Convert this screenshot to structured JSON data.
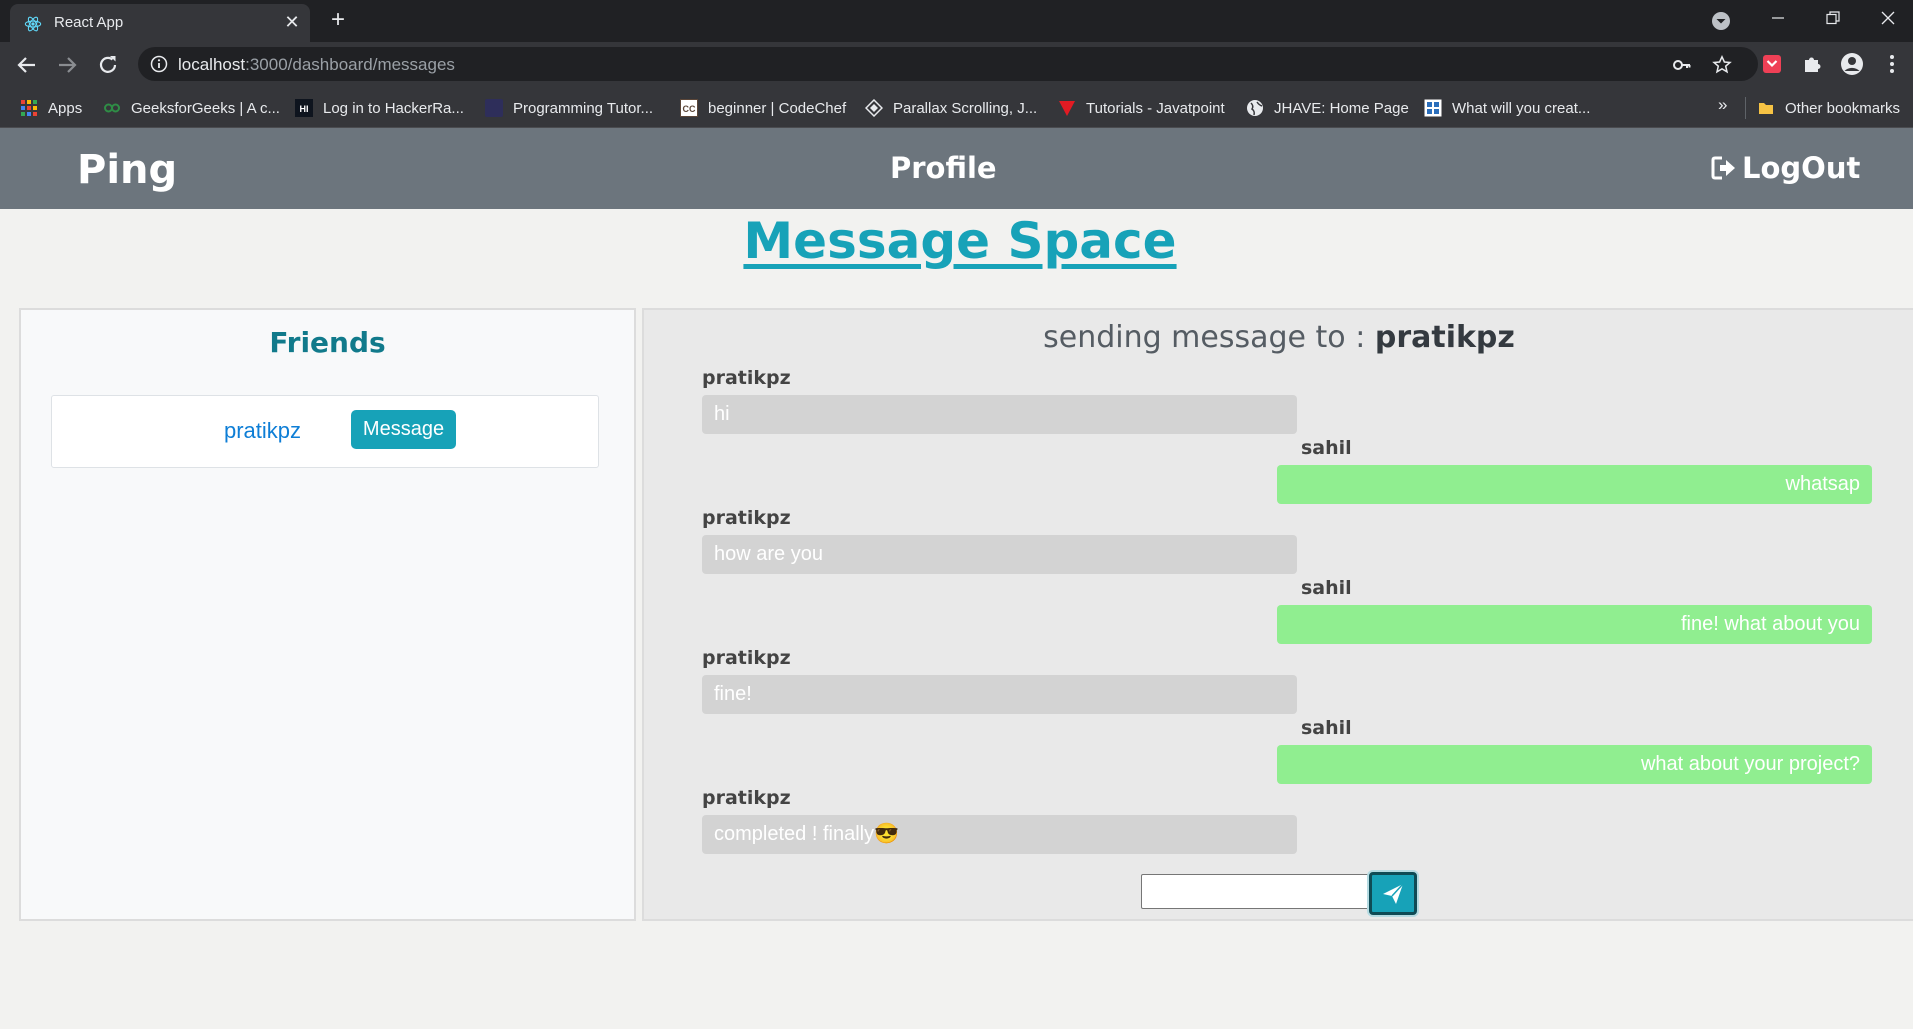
{
  "browser": {
    "tab_title": "React App",
    "tab_close": "✕",
    "new_tab": "+",
    "url_host": "localhost",
    "url_path": ":3000/dashboard/messages",
    "bookmarks": [
      {
        "label": "Apps",
        "icon": "apps-grid-icon"
      },
      {
        "label": "GeeksforGeeks | A c...",
        "icon": "geeksforgeeks-icon"
      },
      {
        "label": "Log in to HackerRa...",
        "icon": "hackerrank-icon"
      },
      {
        "label": "Programming Tutor...",
        "icon": "programiz-icon"
      },
      {
        "label": "beginner | CodeChef",
        "icon": "codechef-icon"
      },
      {
        "label": "Parallax Scrolling, J...",
        "icon": "parallax-icon"
      },
      {
        "label": "Tutorials - Javatpoint",
        "icon": "javatpoint-icon"
      },
      {
        "label": "JHAVE: Home Page",
        "icon": "globe-icon"
      },
      {
        "label": "What will you creat...",
        "icon": "creat-icon"
      }
    ],
    "bookmarks_more": "»",
    "other_bookmarks": "Other bookmarks"
  },
  "app": {
    "brand": "Ping",
    "nav_profile": "Profile",
    "nav_logout": "LogOut",
    "page_title": "Message Space"
  },
  "friends": {
    "title": "Friends",
    "items": [
      {
        "name": "pratikpz",
        "button": "Message"
      }
    ]
  },
  "chat": {
    "header_prefix": "sending message to : ",
    "recipient": "pratikpz",
    "messages": [
      {
        "sender": "pratikpz",
        "text": "hi",
        "direction": "in"
      },
      {
        "sender": "sahil",
        "text": "whatsap",
        "direction": "out"
      },
      {
        "sender": "pratikpz",
        "text": "how are you",
        "direction": "in"
      },
      {
        "sender": "sahil",
        "text": "fine! what about you",
        "direction": "out"
      },
      {
        "sender": "pratikpz",
        "text": "fine!",
        "direction": "in"
      },
      {
        "sender": "sahil",
        "text": "what about your project?",
        "direction": "out"
      },
      {
        "sender": "pratikpz",
        "text": "completed ! finally😎",
        "direction": "in"
      }
    ],
    "input_value": ""
  },
  "colors": {
    "accent": "#17a2b8",
    "navbar": "#6c757d",
    "incoming_bubble": "#d3d3d3",
    "outgoing_bubble": "#90ee90"
  }
}
